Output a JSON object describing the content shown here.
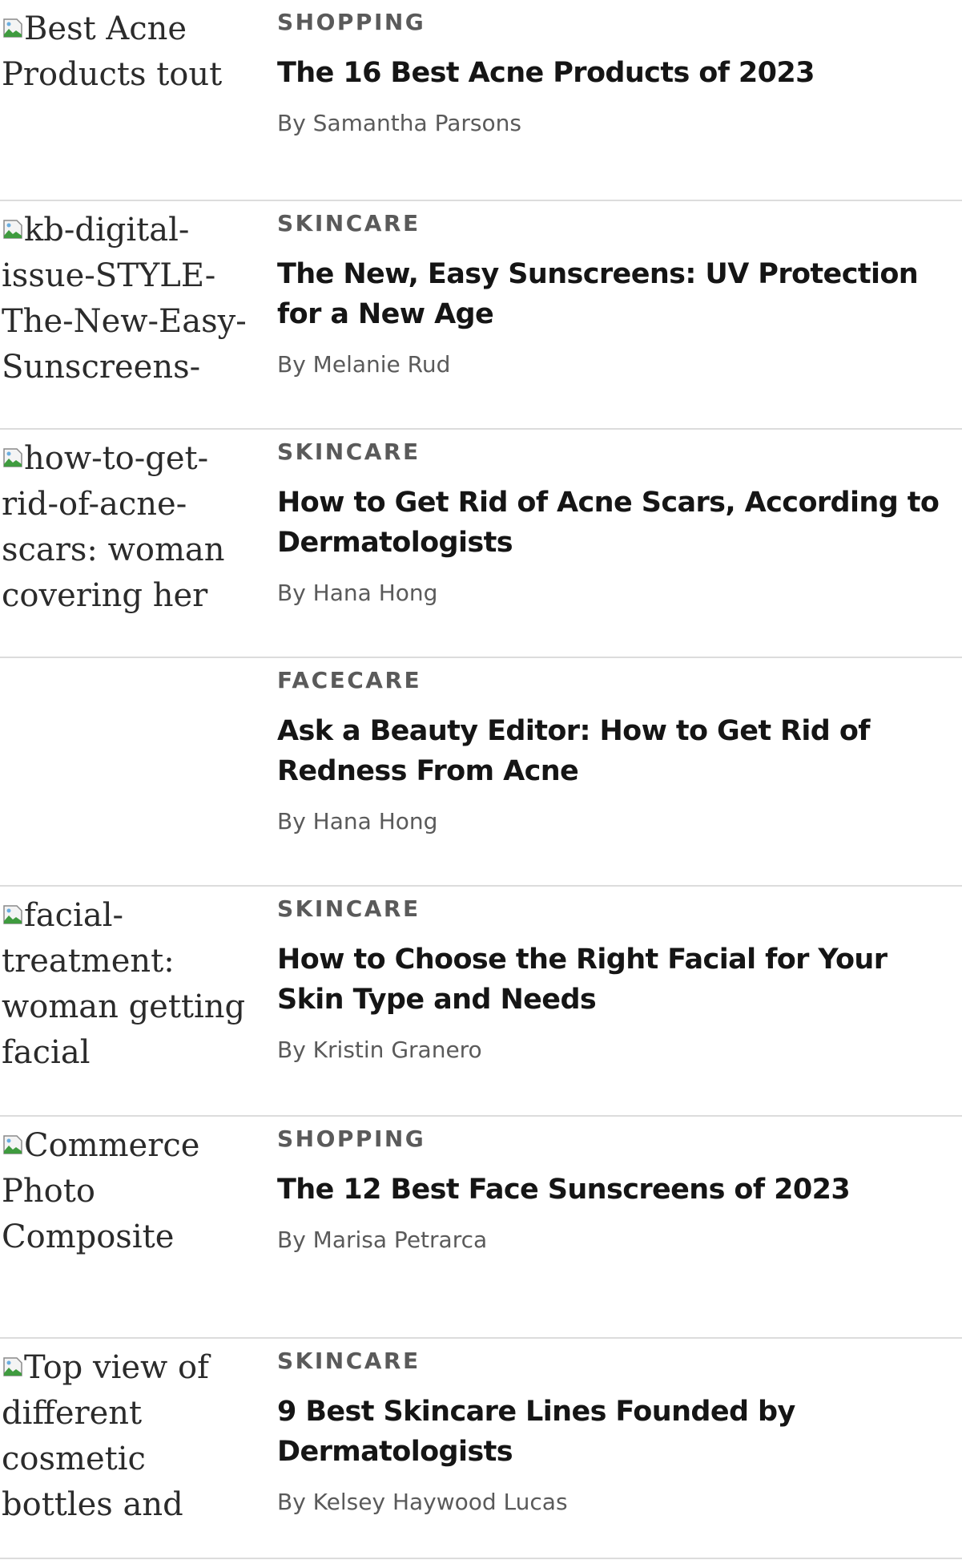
{
  "articles": [
    {
      "image_alt": "Best Acne Products tout",
      "show_image": true,
      "category": "SHOPPING",
      "title": "The 16 Best Acne Products of 2023",
      "author": "By Samantha Parsons"
    },
    {
      "image_alt": "kb-digital-issue-STYLE-The-New-Easy-Sunscreens-",
      "show_image": true,
      "category": "SKINCARE",
      "title": "The New, Easy Sunscreens: UV Protection for a New Age",
      "author": "By Melanie Rud"
    },
    {
      "image_alt": "how-to-get-rid-of-acne-scars: woman covering her face",
      "show_image": true,
      "category": "SKINCARE",
      "title": "How to Get Rid of Acne Scars, According to Dermatologists",
      "author": "By Hana Hong"
    },
    {
      "image_alt": "",
      "show_image": false,
      "category": "FACECARE",
      "title": "Ask a Beauty Editor: How to Get Rid of Redness From Acne",
      "author": "By Hana Hong"
    },
    {
      "image_alt": "facial-treatment: woman getting facial",
      "show_image": true,
      "category": "SKINCARE",
      "title": "How to Choose the Right Facial for Your Skin Type and Needs",
      "author": "By Kristin Granero"
    },
    {
      "image_alt": "Commerce Photo Composite",
      "show_image": true,
      "category": "SHOPPING",
      "title": "The 12 Best Face Sunscreens of 2023",
      "author": "By Marisa Petrarca"
    },
    {
      "image_alt": "Top view of different cosmetic bottles and container",
      "show_image": true,
      "category": "SKINCARE",
      "title": "9 Best Skincare Lines Founded by Dermatologists",
      "author": "By Kelsey Haywood Lucas"
    }
  ],
  "icons": {
    "broken_image": "broken-image-icon"
  },
  "colors": {
    "category_text": "#5a5a5a",
    "title_text": "#151515",
    "author_text": "#5a5a5a",
    "divider": "#dcdcdc"
  }
}
